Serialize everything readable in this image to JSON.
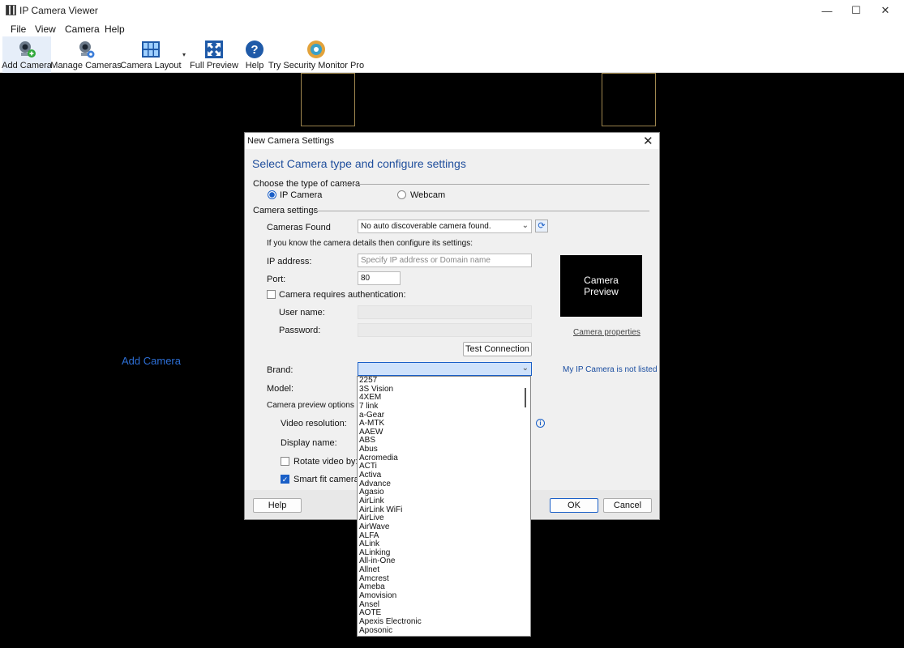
{
  "window": {
    "title": "IP Camera Viewer",
    "min": "—",
    "max": "☐",
    "close": "✕"
  },
  "menu": [
    "File",
    "View",
    "Camera",
    "Help"
  ],
  "toolbar": {
    "add_camera": "Add Camera",
    "manage_cameras": "Manage Cameras",
    "camera_layout": "Camera Layout",
    "full_preview": "Full Preview",
    "help": "Help",
    "try_pro": "Try Security Monitor Pro"
  },
  "main": {
    "add_camera_link": "Add Camera"
  },
  "dialog": {
    "title": "New Camera Settings",
    "close": "✕",
    "heading": "Select Camera type and configure settings",
    "type_group": "Choose the type of camera",
    "ip_camera": "IP Camera",
    "webcam": "Webcam",
    "settings_group": "Camera settings",
    "cameras_found_label": "Cameras Found",
    "cameras_found_value": "No auto discoverable camera found.",
    "refresh": "⟳",
    "details_hint": "If you know the camera details then configure its settings:",
    "ip_label": "IP address:",
    "ip_placeholder": "Specify IP address or Domain name",
    "port_label": "Port:",
    "port_value": "80",
    "auth_label": "Camera requires authentication:",
    "username_label": "User name:",
    "password_label": "Password:",
    "test_connection": "Test Connection",
    "preview_line1": "Camera",
    "preview_line2": "Preview",
    "camera_properties": "Camera properties",
    "brand_label": "Brand:",
    "not_listed": "My IP Camera is not listed",
    "model_label": "Model:",
    "preview_options": "Camera preview options (opti",
    "video_resolution": "Video resolution:",
    "display_name": "Display name:",
    "rotate_video": "Rotate video by:",
    "smart_fit": "Smart fit camera in w",
    "info": "i",
    "help_btn": "Help",
    "ok_btn": "OK",
    "cancel_btn": "Cancel"
  },
  "brand_list": [
    "2257",
    "3S Vision",
    "4XEM",
    "7 link",
    "a-Gear",
    "A-MTK",
    "AAEW",
    "ABS",
    "Abus",
    "Acromedia",
    "ACTi",
    "Activa",
    "Advance",
    "Agasio",
    "AirLink",
    "AirLink WiFi",
    "AirLive",
    "AirWave",
    "ALFA",
    "ALink",
    "ALinking",
    "All-in-One",
    "Allnet",
    "Amcrest",
    "Ameba",
    "Amovision",
    "Ansel",
    "AOTE",
    "Apexis Electronic",
    "Aposonic"
  ],
  "colors": {
    "accent": "#1a5fc7",
    "heading": "#1f4e9c",
    "link": "#2d6fd6"
  }
}
